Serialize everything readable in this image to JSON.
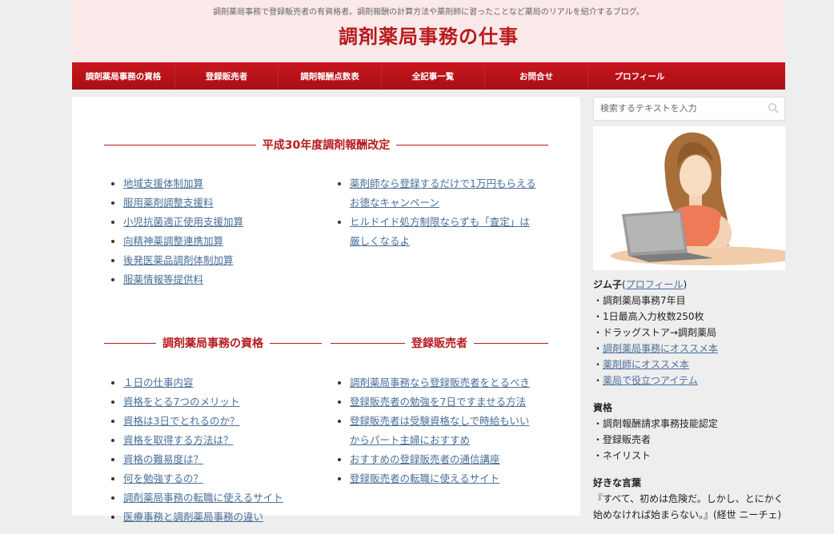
{
  "header": {
    "tagline": "調剤薬局事務で登録販売者の有資格者。調剤報酬の計算方法や薬剤師に習ったことなど薬局のリアルを紹介するブログ。",
    "title": "調剤薬局事務の仕事"
  },
  "nav": [
    "調剤薬局事務の資格",
    "登録販売者",
    "調剤報酬点数表",
    "全記事一覧",
    "お問合せ",
    "プロフィール"
  ],
  "sections": {
    "h30": {
      "title": "平成30年度調剤報酬改定",
      "left": [
        "地域支援体制加算",
        "服用薬剤調整支援料",
        "小児抗菌適正使用支援加算",
        "向精神薬調整連携加算",
        "後発医薬品調剤体制加算",
        "服薬情報等提供料"
      ],
      "right": [
        "薬剤師なら登録するだけで1万円もらえるお徳なキャンペーン",
        "ヒルドイド処方制限ならずも「査定」は厳しくなるよ"
      ]
    },
    "qual": {
      "title": "調剤薬局事務の資格",
      "items": [
        "１日の仕事内容",
        "資格をとる7つのメリット",
        "資格は3日でとれるのか？",
        "資格を取得する方法は？",
        "資格の難易度は？",
        "何を勉強するの？",
        "調剤薬局事務の転職に使えるサイト",
        "医療事務と調剤薬局事務の違い"
      ]
    },
    "seller": {
      "title": "登録販売者",
      "items": [
        "調剤薬局事務なら登録販売者をとるべき",
        "登録販売者の勉強を7日ですませる方法",
        "登録販売者は受験資格なしで時給もいいからパート主婦におすすめ",
        "おすすめの登録販売者の通信講座",
        "登録販売者の転職に使えるサイト"
      ]
    }
  },
  "sidebar": {
    "search_placeholder": "検索するテキストを入力",
    "profile": {
      "name": "ジム子",
      "paren_open": "(",
      "link": "プロフィール",
      "paren_close": ")",
      "lines": [
        "・調剤薬局事務7年目",
        "・1日最高入力枚数250枚",
        "・ドラッグストア→調剤薬局"
      ],
      "bullet": "・",
      "links": [
        "調剤薬局事務にオススメ本",
        "薬剤師にオススメ本",
        "薬局で役立つアイテム"
      ]
    },
    "qualifications": {
      "heading": "資格",
      "items": [
        "・調剤報酬請求事務技能認定",
        "・登録販売者",
        "・ネイリスト"
      ]
    },
    "favorite": {
      "heading": "好きな言葉",
      "quote": "『すべて、初めは危険だ。しかし、とにかく始めなければ始まらない。』(経世 ニーチェ)"
    }
  },
  "colors": {
    "accent": "#b61b20",
    "header_bg": "#fbe8e8",
    "link": "#4a6f99"
  }
}
